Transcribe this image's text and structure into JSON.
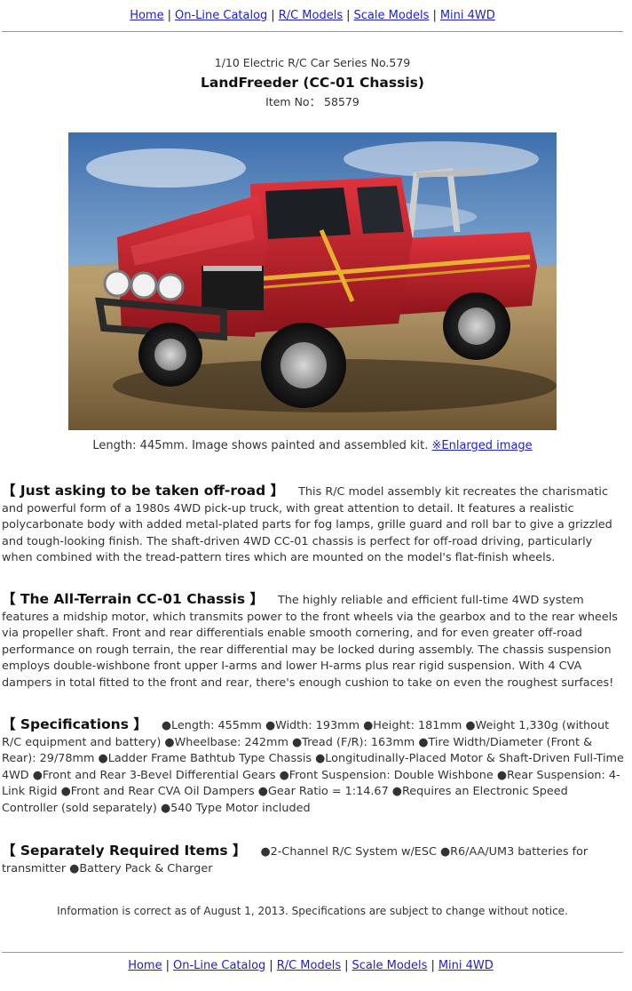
{
  "nav": {
    "items": [
      {
        "label": "Home"
      },
      {
        "label": "On-Line Catalog"
      },
      {
        "label": "R/C Models"
      },
      {
        "label": "Scale Models"
      },
      {
        "label": "Mini 4WD"
      }
    ],
    "separator": "|"
  },
  "product": {
    "series": "1/10 Electric R/C Car Series No.579",
    "title": "LandFreeder (CC-01 Chassis)",
    "item_no": "Item No： 58579",
    "caption_text": "Length: 445mm. Image shows painted and assembled kit. ",
    "enlarged_link": "※Enlarged image"
  },
  "sections": [
    {
      "heading": "【 Just asking to be taken off-road 】",
      "body": "This R/C model assembly kit recreates the charismatic and powerful form of a 1980s 4WD pick-up truck, with great attention to detail. It features a realistic polycarbonate body with added metal-plated parts for fog lamps, grille guard and roll bar to give a grizzled and tough-looking finish. The shaft-driven 4WD CC-01 chassis is perfect for off-road driving, particularly when combined with the tread-pattern tires which are mounted on the model's flat-finish wheels."
    },
    {
      "heading": "【 The All-Terrain CC-01 Chassis 】",
      "body": "The highly reliable and efficient full-time 4WD system features a midship motor, which transmits power to the front wheels via the gearbox and to the rear wheels via propeller shaft. Front and rear differentials enable smooth cornering, and for even greater off-road performance on rough terrain, the rear differential may be locked during assembly. The chassis suspension employs double-wishbone front upper I-arms and lower H-arms plus rear rigid suspension. With 4 CVA dampers in total fitted to the front and rear, there's enough cushion to take on even the roughest surfaces!"
    },
    {
      "heading": "【 Specifications 】",
      "body": "●Length: 455mm ●Width: 193mm ●Height: 181mm ●Weight 1,330g (without R/C equipment and battery) ●Wheelbase: 242mm ●Tread (F/R): 163mm ●Tire Width/Diameter (Front & Rear): 29/78mm ●Ladder Frame Bathtub Type Chassis ●Longitudinally-Placed Motor & Shaft-Driven Full-Time 4WD ●Front and Rear 3-Bevel Differential Gears ●Front Suspension: Double Wishbone ●Rear Suspension: 4-Link Rigid ●Front and Rear CVA Oil Dampers ●Gear Ratio = 1:14.67 ●Requires an Electronic Speed Controller (sold separately) ●540 Type Motor included"
    },
    {
      "heading": "【 Separately Required Items 】",
      "body": "●2-Channel R/C System w/ESC ●R6/AA/UM3 batteries for transmitter ●Battery Pack & Charger"
    }
  ],
  "footnote": "Information is correct as of August 1, 2013. Specifications are subject to change without notice.",
  "colors": {
    "link": "#1f1fcc",
    "truck_body": "#c8202a",
    "sky": "#4a7fb8",
    "ground": "#a98a5c"
  }
}
